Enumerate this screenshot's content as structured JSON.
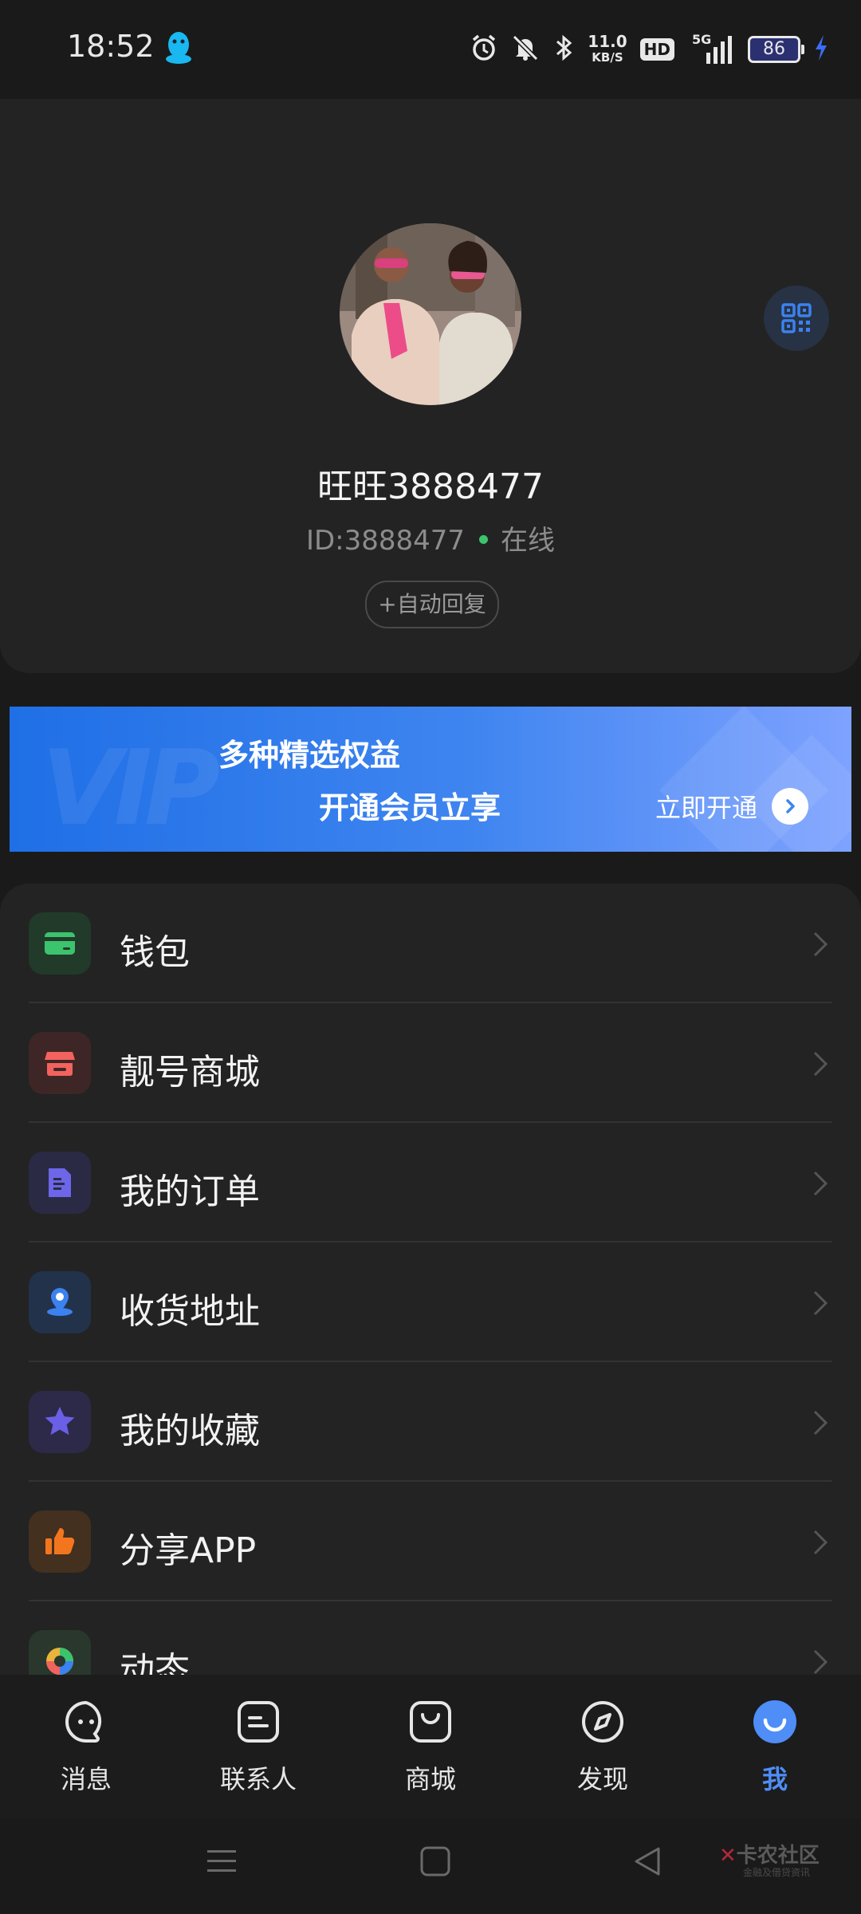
{
  "status_bar": {
    "time": "18:52",
    "net_speed_value": "11.0",
    "net_speed_unit": "KB/S",
    "hd": "HD",
    "network": "5G",
    "battery": "86"
  },
  "profile": {
    "username": "旺旺3888477",
    "user_id": "ID:3888477",
    "status": "在线",
    "auto_reply": "+自动回复"
  },
  "vip_banner": {
    "watermark": "VIP",
    "line1": "多种精选权益",
    "line2": "开通会员立享",
    "cta": "立即开通"
  },
  "menu": {
    "items": [
      {
        "label": "钱包",
        "icon": "wallet-icon",
        "color": "#3cc36d",
        "bg": "#213a2a"
      },
      {
        "label": "靓号商城",
        "icon": "store-icon",
        "color": "#f2625f",
        "bg": "#3f2626"
      },
      {
        "label": "我的订单",
        "icon": "order-icon",
        "color": "#6e66e8",
        "bg": "#2a2a45"
      },
      {
        "label": "收货地址",
        "icon": "location-icon",
        "color": "#3b82f0",
        "bg": "#23324b"
      },
      {
        "label": "我的收藏",
        "icon": "star-icon",
        "color": "#6a5fe6",
        "bg": "#2c2a48"
      },
      {
        "label": "分享APP",
        "icon": "thumbs-up-icon",
        "color": "#f3761e",
        "bg": "#43301f"
      },
      {
        "label": "动态",
        "icon": "moments-icon",
        "color": "#e8b43c",
        "bg": "#29372c"
      }
    ]
  },
  "bottom_nav": {
    "items": [
      {
        "label": "消息",
        "icon": "message-icon"
      },
      {
        "label": "联系人",
        "icon": "contacts-icon"
      },
      {
        "label": "商城",
        "icon": "shop-bag-icon"
      },
      {
        "label": "发现",
        "icon": "compass-icon"
      },
      {
        "label": "我",
        "icon": "me-icon"
      }
    ],
    "active_color": "#4f8df7"
  },
  "watermark": {
    "text": "卡农社区",
    "sub": "金融及借贷资讯"
  }
}
